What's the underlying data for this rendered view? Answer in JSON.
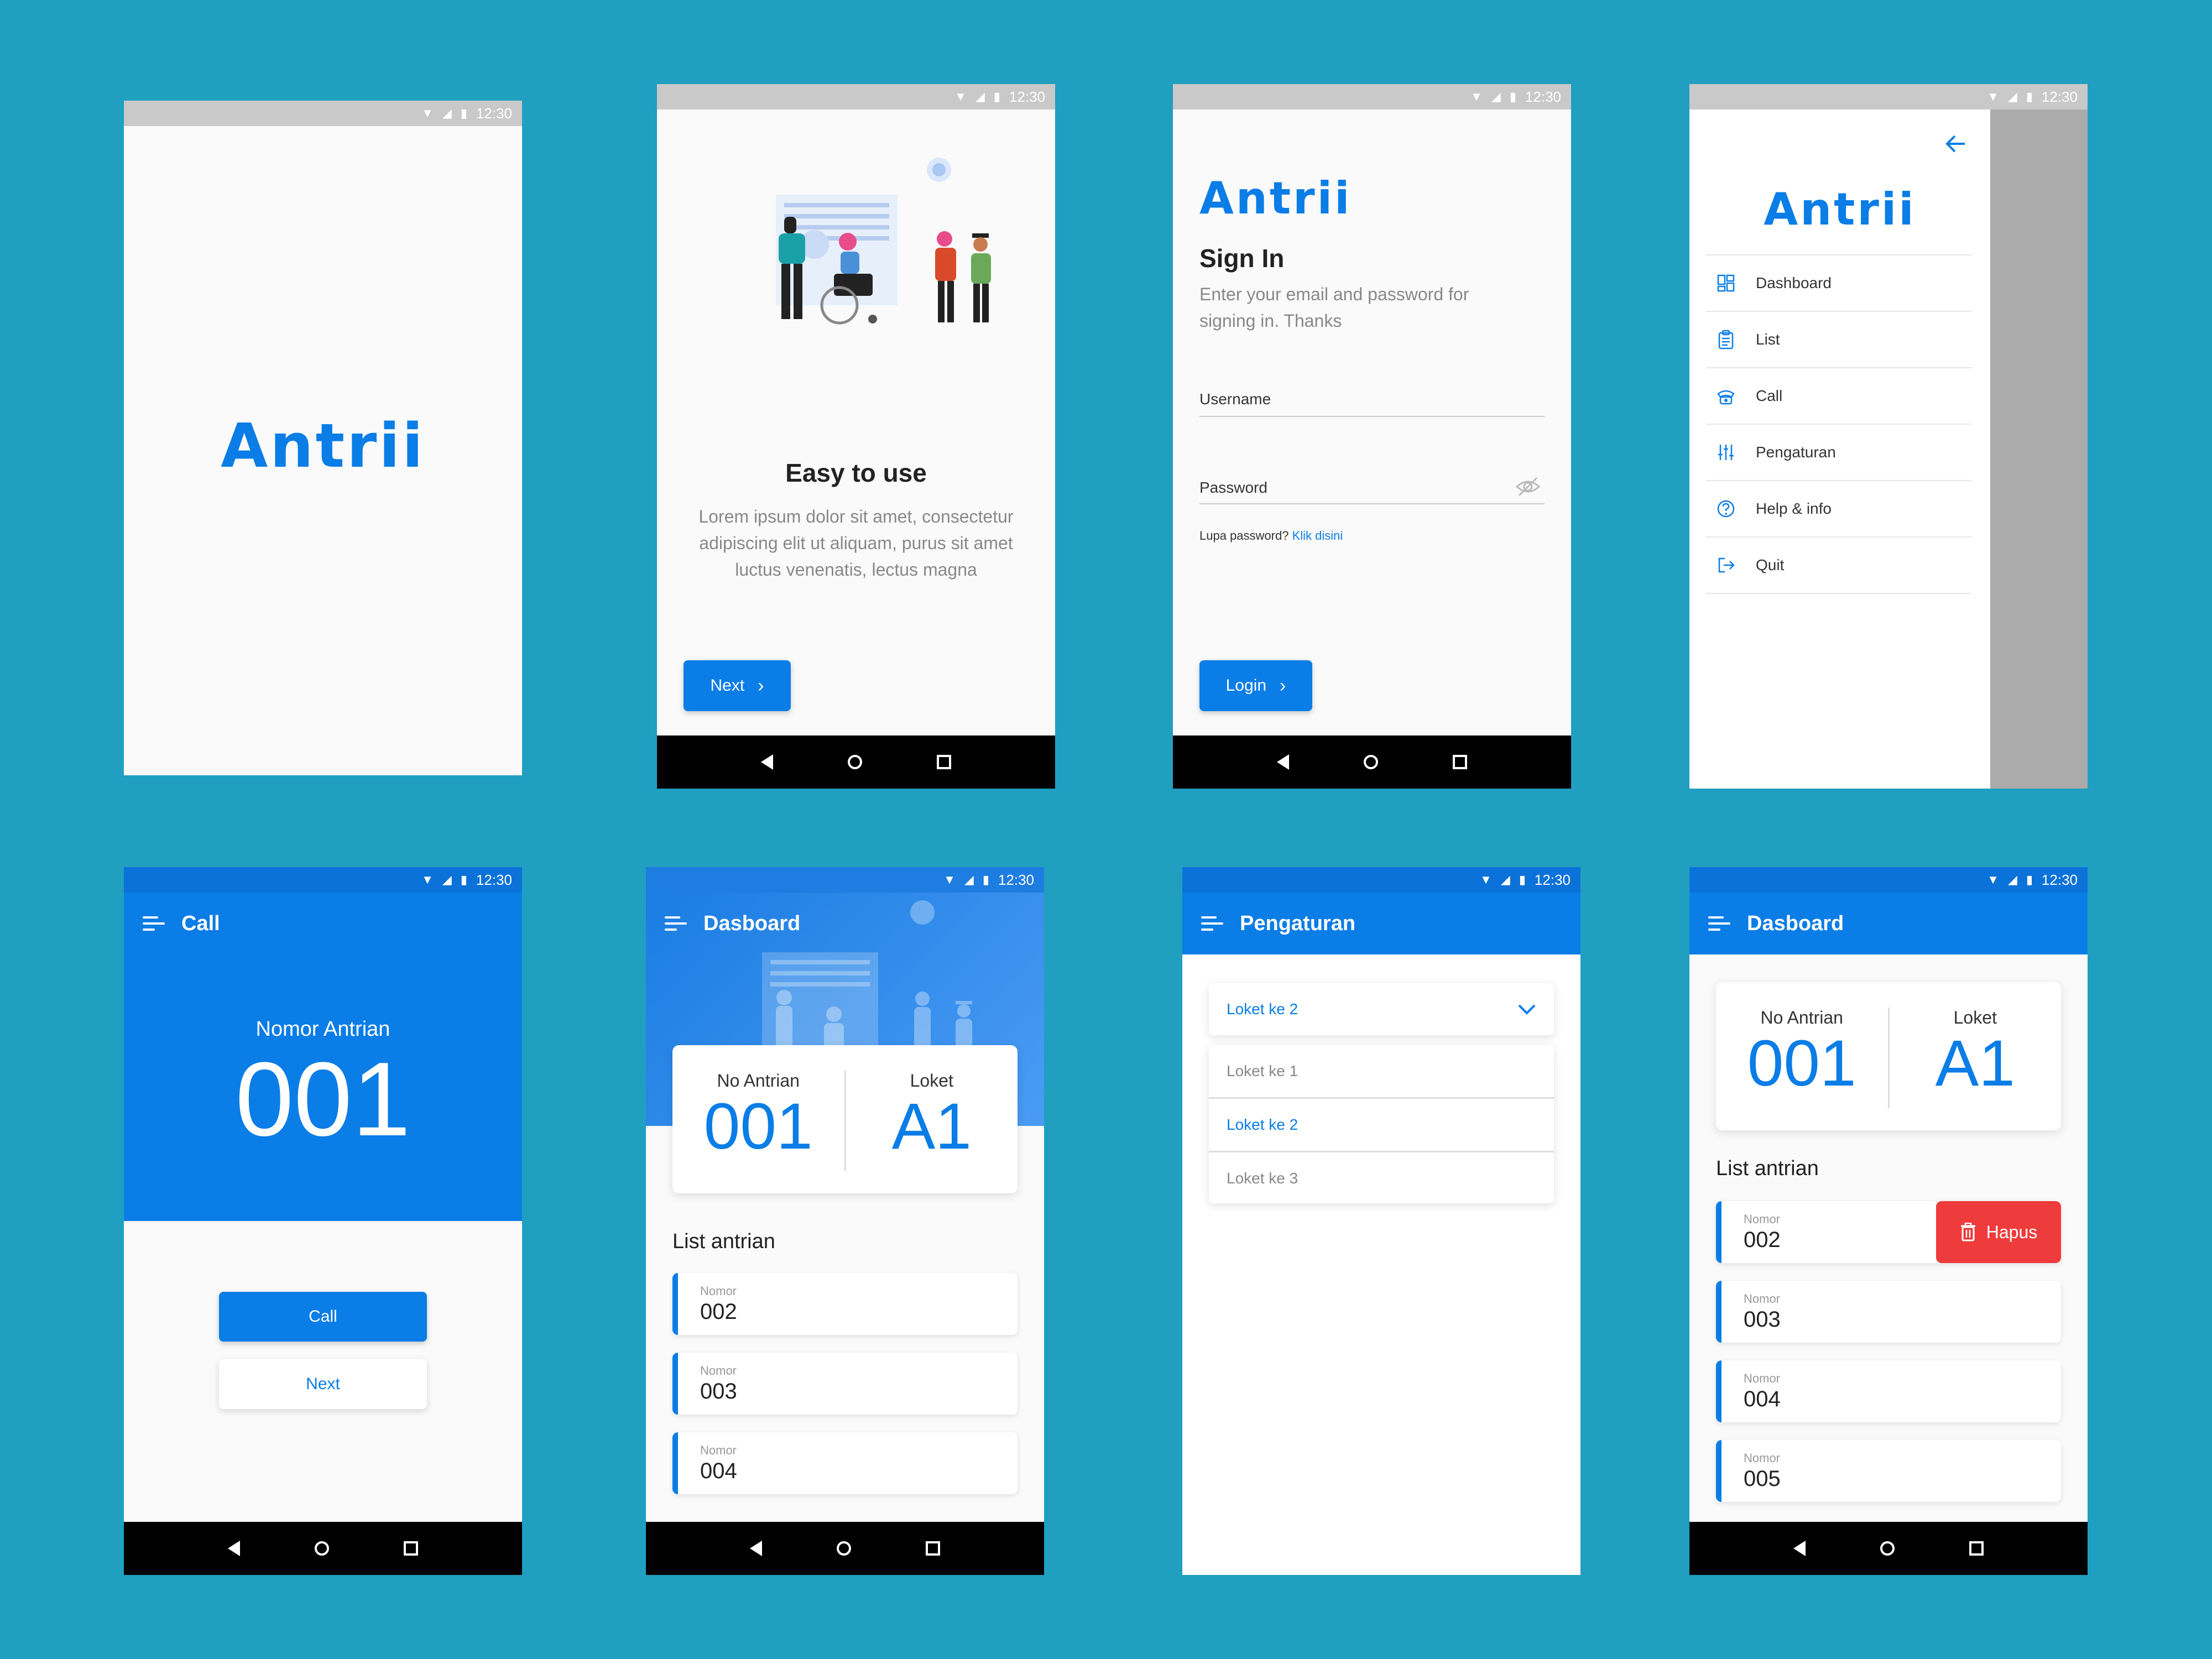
{
  "status": {
    "time": "12:30"
  },
  "splash": {
    "logo": "Antrii"
  },
  "onboarding": {
    "title": "Easy to use",
    "body": "Lorem ipsum dolor sit amet, consectetur adipiscing elit ut aliquam, purus sit amet luctus venenatis, lectus magna",
    "next_label": "Next"
  },
  "signin": {
    "logo": "Antrii",
    "title": "Sign In",
    "subtitle": "Enter your email and password for signing in. Thanks",
    "username_label": "Username",
    "password_label": "Password",
    "forgot_text": "Lupa password?",
    "forgot_link": "Klik disini",
    "login_label": "Login"
  },
  "drawer": {
    "logo": "Antrii",
    "items": [
      {
        "label": "Dashboard",
        "icon": "dashboard-icon"
      },
      {
        "label": "List",
        "icon": "clipboard-icon"
      },
      {
        "label": "Call",
        "icon": "phone-icon"
      },
      {
        "label": "Pengaturan",
        "icon": "sliders-icon"
      },
      {
        "label": "Help & info",
        "icon": "help-icon"
      },
      {
        "label": "Quit",
        "icon": "logout-icon"
      }
    ]
  },
  "call_screen": {
    "title": "Call",
    "queue_label": "Nomor Antrian",
    "queue_number": "001",
    "call_label": "Call",
    "next_label": "Next"
  },
  "dashboard1": {
    "title": "Dasboard",
    "no_antrian_label": "No Antrian",
    "no_antrian_value": "001",
    "loket_label": "Loket",
    "loket_value": "A1",
    "list_title": "List antrian",
    "items": [
      {
        "label": "Nomor",
        "value": "002"
      },
      {
        "label": "Nomor",
        "value": "003"
      },
      {
        "label": "Nomor",
        "value": "004"
      }
    ]
  },
  "settings": {
    "title": "Pengaturan",
    "selected": "Loket ke 2",
    "options": [
      "Loket ke 1",
      "Loket ke 2",
      "Loket ke 3"
    ]
  },
  "dashboard2": {
    "title": "Dasboard",
    "no_antrian_label": "No Antrian",
    "no_antrian_value": "001",
    "loket_label": "Loket",
    "loket_value": "A1",
    "list_title": "List antrian",
    "delete_label": "Hapus",
    "items": [
      {
        "label": "Nomor",
        "value": "002"
      },
      {
        "label": "Nomor",
        "value": "003"
      },
      {
        "label": "Nomor",
        "value": "004"
      },
      {
        "label": "Nomor",
        "value": "005"
      }
    ]
  },
  "colors": {
    "primary": "#0a7de6",
    "danger": "#ee3b3b",
    "background": "#209fc0"
  }
}
